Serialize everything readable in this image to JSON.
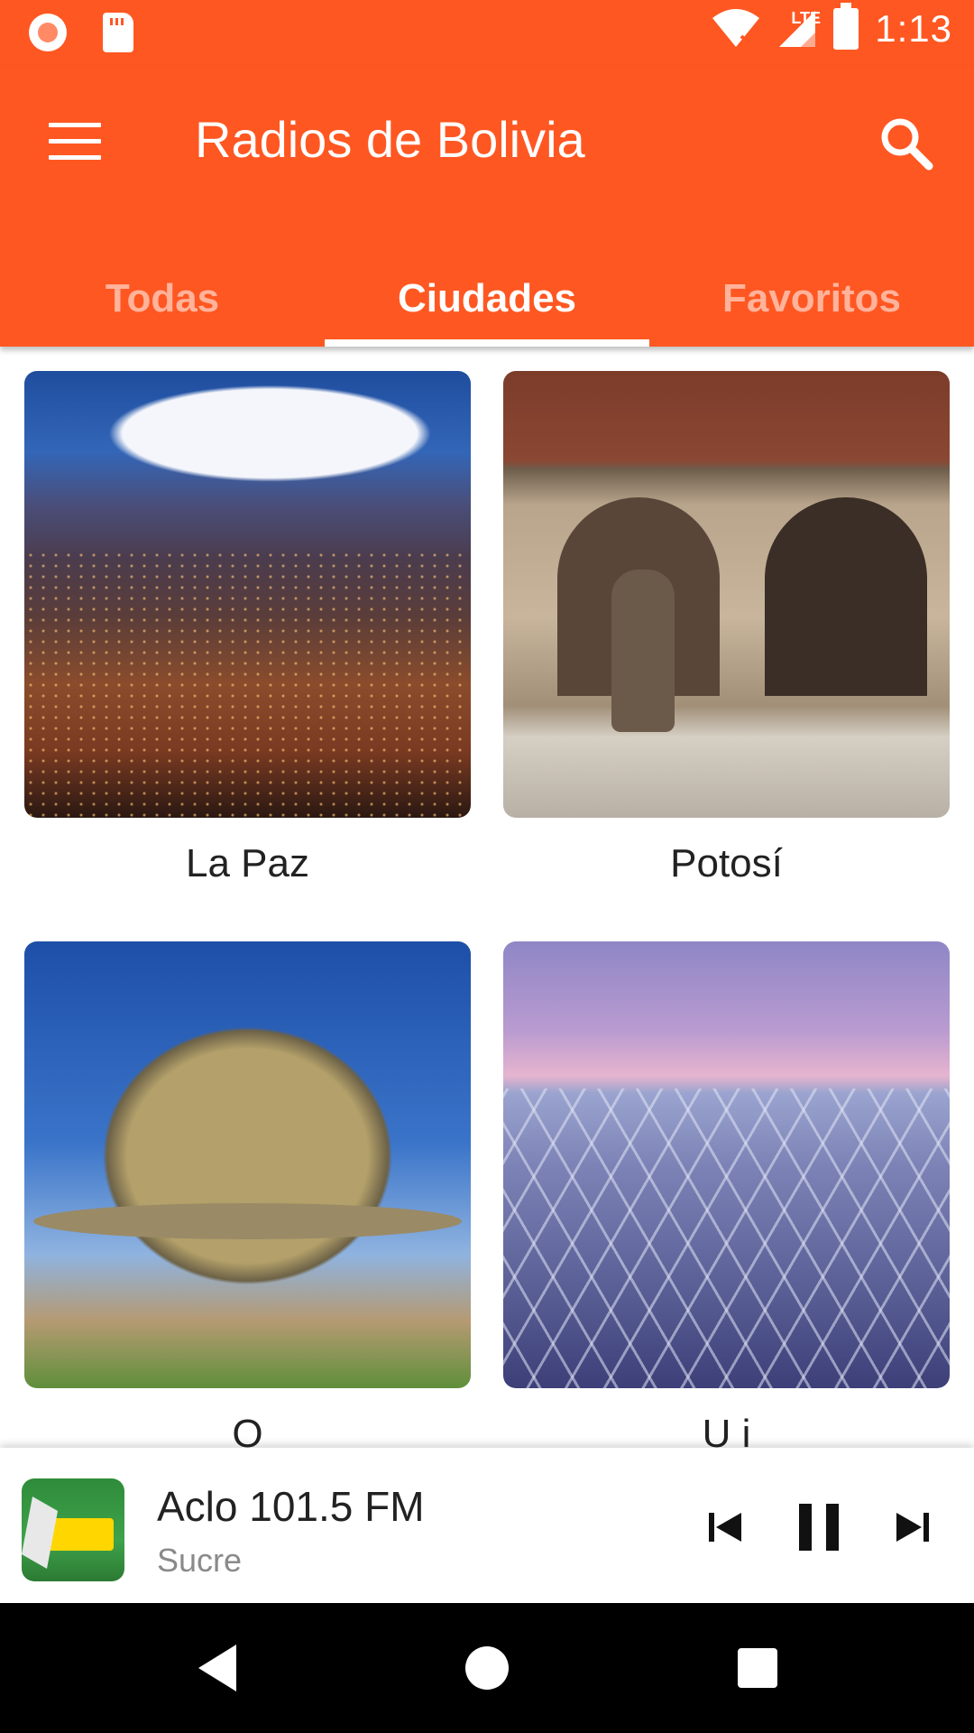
{
  "status_bar": {
    "time": "1:13",
    "network": "LTE"
  },
  "app_bar": {
    "title": "Radios de Bolivia",
    "menu_icon": "hamburger-menu-icon",
    "search_icon": "search-icon",
    "color": "#ff5722"
  },
  "tabs": [
    {
      "label": "Todas",
      "active": false
    },
    {
      "label": "Ciudades",
      "active": true
    },
    {
      "label": "Favoritos",
      "active": false
    }
  ],
  "cities": [
    {
      "name": "La Paz"
    },
    {
      "name": "Potosí"
    },
    {
      "name": "O"
    },
    {
      "name": "U i"
    }
  ],
  "player": {
    "station": "Aclo 101.5 FM",
    "city": "Sucre",
    "state": "playing",
    "controls": [
      "skip-previous-icon",
      "pause-icon",
      "skip-next-icon"
    ]
  },
  "nav_bar": {
    "buttons": [
      "back-icon",
      "home-icon",
      "recents-icon"
    ]
  }
}
